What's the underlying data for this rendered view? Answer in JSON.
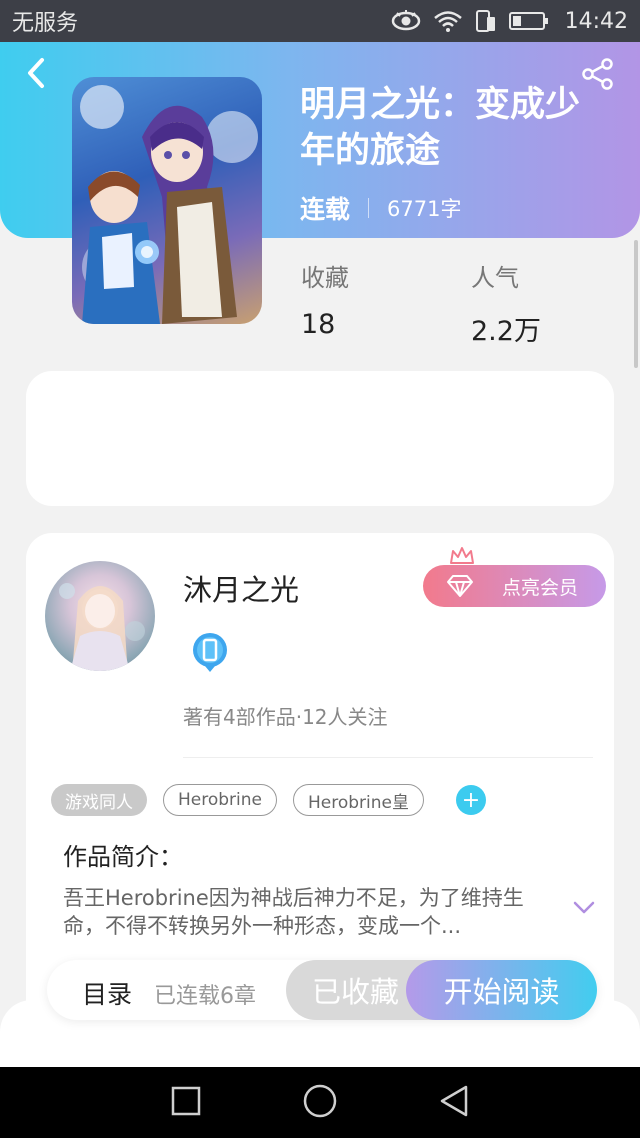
{
  "status_bar": {
    "carrier": "无服务",
    "time": "14:42"
  },
  "book": {
    "title": "明月之光：变成少年的旅途",
    "status": "连载",
    "word_count": "6771字",
    "stats": [
      {
        "label": "收藏",
        "value": "18"
      },
      {
        "label": "人气",
        "value": "2.2万"
      }
    ]
  },
  "author": {
    "name": "沐月之光",
    "vip_label": "点亮会员",
    "meta": "著有4部作品·12人关注"
  },
  "tags": [
    "游戏同人",
    "Herobrine",
    "Herobrine皇"
  ],
  "intro": {
    "title": "作品简介：",
    "text": "吾王Herobrine因为神战后神力不足，为了维持生命，不得不转换另外一种形态，变成一个..."
  },
  "action_bar": {
    "toc_label": "目录",
    "toc_count": "已连载6章",
    "favorite_label": "已收藏",
    "read_label": "开始阅读"
  },
  "colors": {
    "header_gradient_start": "#3fcdef",
    "header_gradient_end": "#b295e6",
    "accent_cyan": "#3ccbef",
    "vip_gradient_start": "#f27a8c",
    "vip_gradient_end": "#c69ae8"
  },
  "icons": {
    "back": "chevron-left-icon",
    "share": "share-icon",
    "expand": "chevron-down-icon",
    "badge": "phone-badge-icon",
    "crown": "crown-icon",
    "vip": "diamond-icon"
  }
}
